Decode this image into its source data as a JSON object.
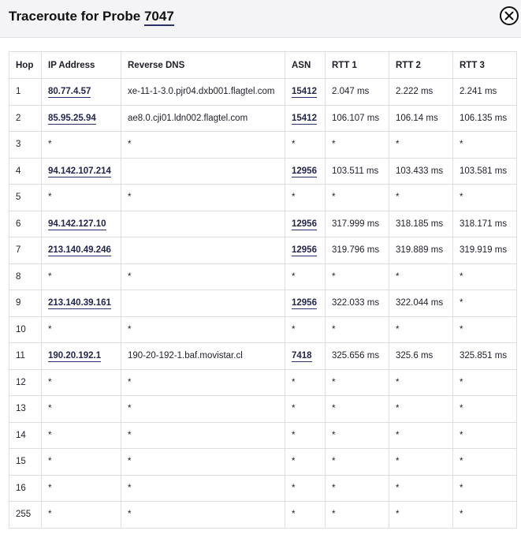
{
  "header": {
    "title_prefix": "Traceroute for Probe",
    "probe_id": "7047"
  },
  "columns": [
    "Hop",
    "IP Address",
    "Reverse DNS",
    "ASN",
    "RTT 1",
    "RTT 2",
    "RTT 3"
  ],
  "rows": [
    {
      "hop": "1",
      "ip": "80.77.4.57",
      "dns": "xe-11-1-3.0.pjr04.dxb001.flagtel.com",
      "asn": "15412",
      "rtt1": "2.047 ms",
      "rtt2": "2.222 ms",
      "rtt3": "2.241 ms"
    },
    {
      "hop": "2",
      "ip": "85.95.25.94",
      "dns": "ae8.0.cji01.ldn002.flagtel.com",
      "asn": "15412",
      "rtt1": "106.107 ms",
      "rtt2": "106.14 ms",
      "rtt3": "106.135 ms"
    },
    {
      "hop": "3",
      "ip": "*",
      "dns": "*",
      "asn": "*",
      "rtt1": "*",
      "rtt2": "*",
      "rtt3": "*"
    },
    {
      "hop": "4",
      "ip": "94.142.107.214",
      "dns": "",
      "asn": "12956",
      "rtt1": "103.511 ms",
      "rtt2": "103.433 ms",
      "rtt3": "103.581 ms"
    },
    {
      "hop": "5",
      "ip": "*",
      "dns": "*",
      "asn": "*",
      "rtt1": "*",
      "rtt2": "*",
      "rtt3": "*"
    },
    {
      "hop": "6",
      "ip": "94.142.127.10",
      "dns": "",
      "asn": "12956",
      "rtt1": "317.999 ms",
      "rtt2": "318.185 ms",
      "rtt3": "318.171 ms"
    },
    {
      "hop": "7",
      "ip": "213.140.49.246",
      "dns": "",
      "asn": "12956",
      "rtt1": "319.796 ms",
      "rtt2": "319.889 ms",
      "rtt3": "319.919 ms"
    },
    {
      "hop": "8",
      "ip": "*",
      "dns": "*",
      "asn": "*",
      "rtt1": "*",
      "rtt2": "*",
      "rtt3": "*"
    },
    {
      "hop": "9",
      "ip": "213.140.39.161",
      "dns": "",
      "asn": "12956",
      "rtt1": "322.033 ms",
      "rtt2": "322.044 ms",
      "rtt3": "*"
    },
    {
      "hop": "10",
      "ip": "*",
      "dns": "*",
      "asn": "*",
      "rtt1": "*",
      "rtt2": "*",
      "rtt3": "*"
    },
    {
      "hop": "11",
      "ip": "190.20.192.1",
      "dns": "190-20-192-1.baf.movistar.cl",
      "asn": "7418",
      "rtt1": "325.656 ms",
      "rtt2": "325.6 ms",
      "rtt3": "325.851 ms"
    },
    {
      "hop": "12",
      "ip": "*",
      "dns": "*",
      "asn": "*",
      "rtt1": "*",
      "rtt2": "*",
      "rtt3": "*"
    },
    {
      "hop": "13",
      "ip": "*",
      "dns": "*",
      "asn": "*",
      "rtt1": "*",
      "rtt2": "*",
      "rtt3": "*"
    },
    {
      "hop": "14",
      "ip": "*",
      "dns": "*",
      "asn": "*",
      "rtt1": "*",
      "rtt2": "*",
      "rtt3": "*"
    },
    {
      "hop": "15",
      "ip": "*",
      "dns": "*",
      "asn": "*",
      "rtt1": "*",
      "rtt2": "*",
      "rtt3": "*"
    },
    {
      "hop": "16",
      "ip": "*",
      "dns": "*",
      "asn": "*",
      "rtt1": "*",
      "rtt2": "*",
      "rtt3": "*"
    },
    {
      "hop": "255",
      "ip": "*",
      "dns": "*",
      "asn": "*",
      "rtt1": "*",
      "rtt2": "*",
      "rtt3": "*"
    }
  ],
  "icons": {
    "close": "close-icon"
  },
  "colors": {
    "link_underline": "#2b2f6b",
    "header_bg": "#f4f4f6",
    "border": "#dddde2"
  }
}
